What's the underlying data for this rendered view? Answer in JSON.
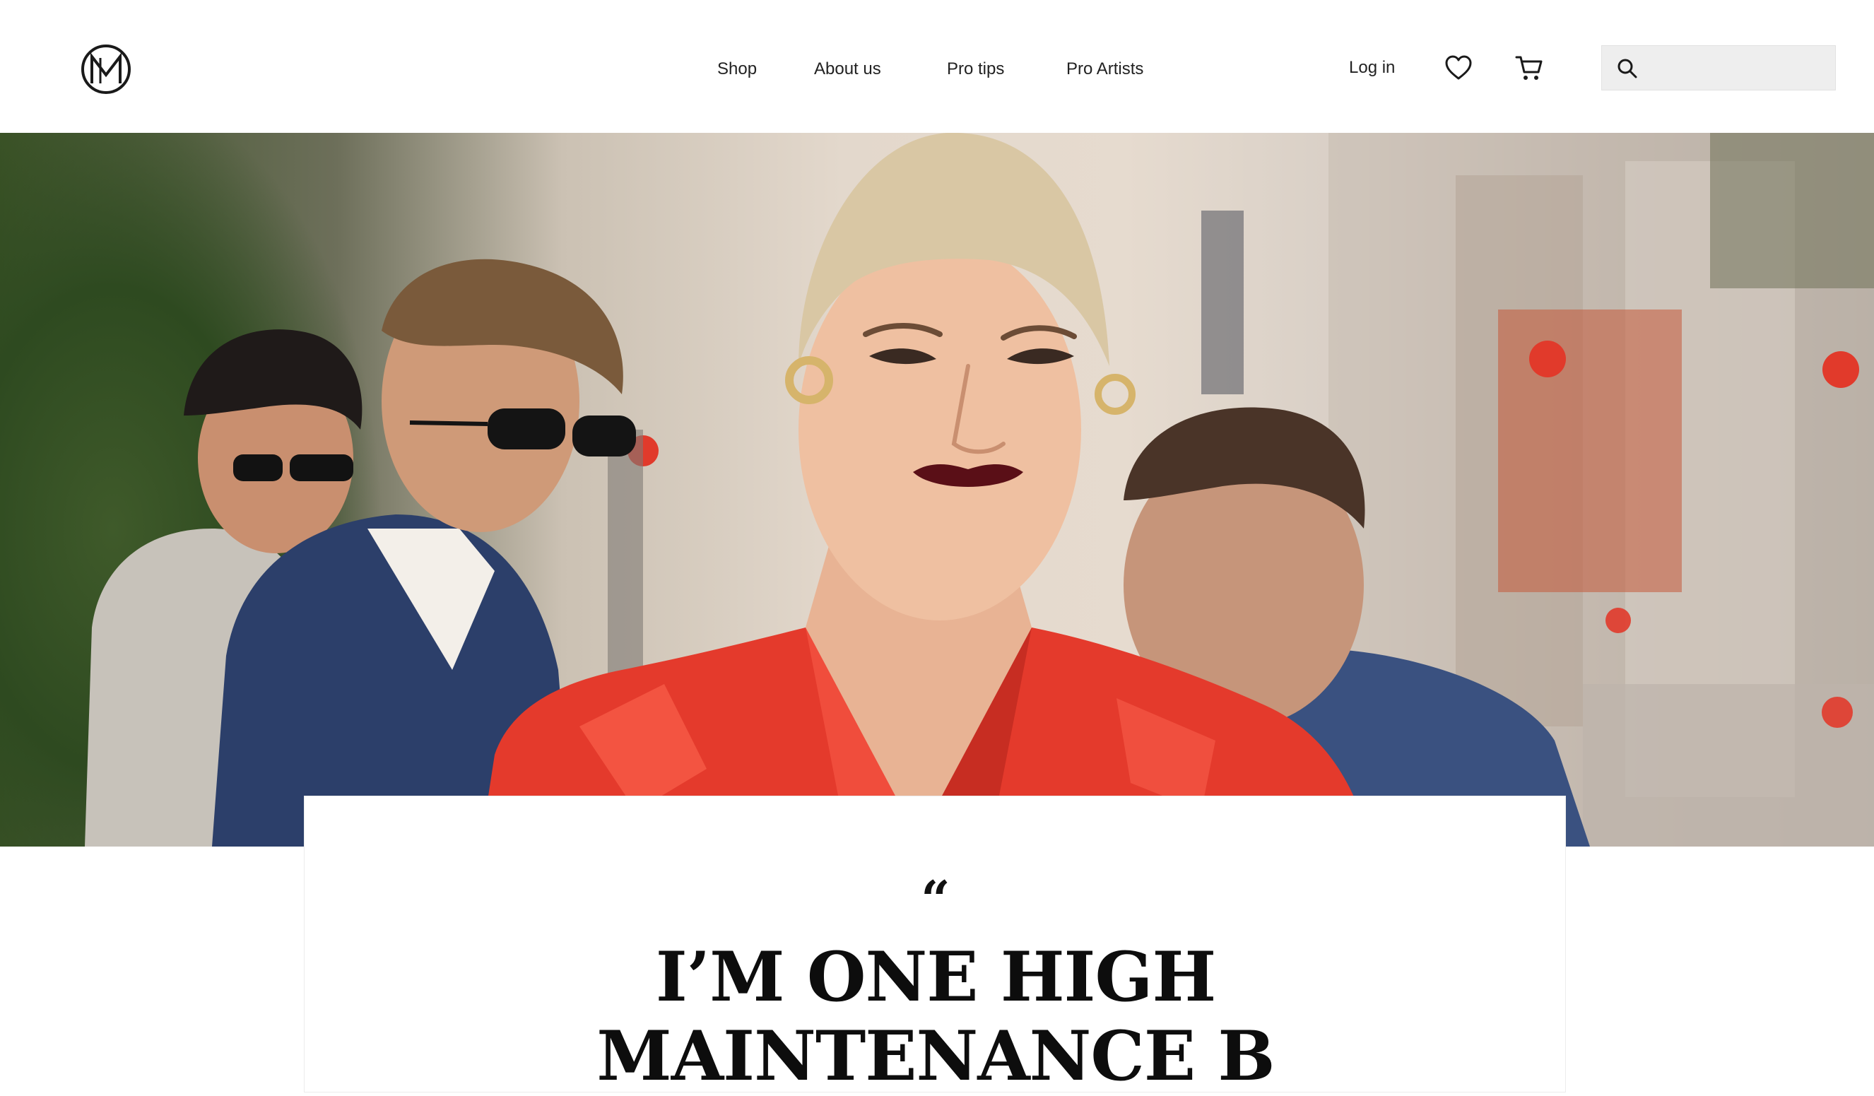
{
  "header": {
    "nav": [
      {
        "label": "Shop"
      },
      {
        "label": "About us"
      },
      {
        "label": "Pro tips"
      },
      {
        "label": "Pro Artists"
      }
    ],
    "login_label": "Log in",
    "icons": {
      "logo": "brand-monogram-logo",
      "wishlist": "heart-icon",
      "cart": "cart-icon",
      "search": "search-icon"
    },
    "search": {
      "value": "",
      "placeholder": ""
    }
  },
  "hero": {
    "image": "street-style-woman-red-vinyl-coat"
  },
  "quote": {
    "mark": "“",
    "text": "I’M ONE HIGH\nMAINTENANCE B"
  },
  "colors": {
    "coat_red": "#e43a2c",
    "suit_navy": "#2c3f6a",
    "foliage_green": "#3a5226"
  }
}
